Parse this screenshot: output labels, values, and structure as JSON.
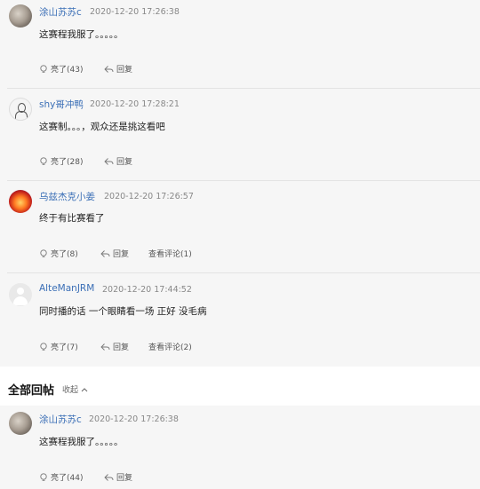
{
  "replies": [
    {
      "avatar": "cat-avatar",
      "username": "涂山苏苏c",
      "time": "2020-12-20 17:26:38",
      "content": "这赛程我服了。。。。。",
      "like_label": "亮了(43)",
      "reply_label": "回复",
      "view_comments_label": ""
    },
    {
      "avatar": "sketch-avatar",
      "username": "shy哥冲鸭",
      "time": "2020-12-20 17:28:21",
      "content": "这赛制。。。，观众还是挑这看吧",
      "like_label": "亮了(28)",
      "reply_label": "回复",
      "view_comments_label": ""
    },
    {
      "avatar": "fire-avatar",
      "username": "乌兹杰克小姜",
      "time": "2020-12-20 17:26:57",
      "content": "终于有比赛看了",
      "like_label": "亮了(8)",
      "reply_label": "回复",
      "view_comments_label": "查看评论(1)"
    },
    {
      "avatar": "default-avatar",
      "username": "AlteManJRM",
      "time": "2020-12-20 17:44:52",
      "content": "同时播的话 一个眼睛看一场 正好 没毛病",
      "like_label": "亮了(7)",
      "reply_label": "回复",
      "view_comments_label": "查看评论(2)"
    }
  ],
  "all_replies": {
    "title": "全部回帖",
    "collapse_label": "收起",
    "items": [
      {
        "avatar": "cat-avatar",
        "username": "涂山苏苏c",
        "time": "2020-12-20 17:26:38",
        "content": "这赛程我服了。。。。。",
        "like_label": "亮了(44)",
        "reply_label": "回复"
      }
    ]
  },
  "colors": {
    "username": "#3b6fb6",
    "section_bg": "#f6f6f6"
  }
}
